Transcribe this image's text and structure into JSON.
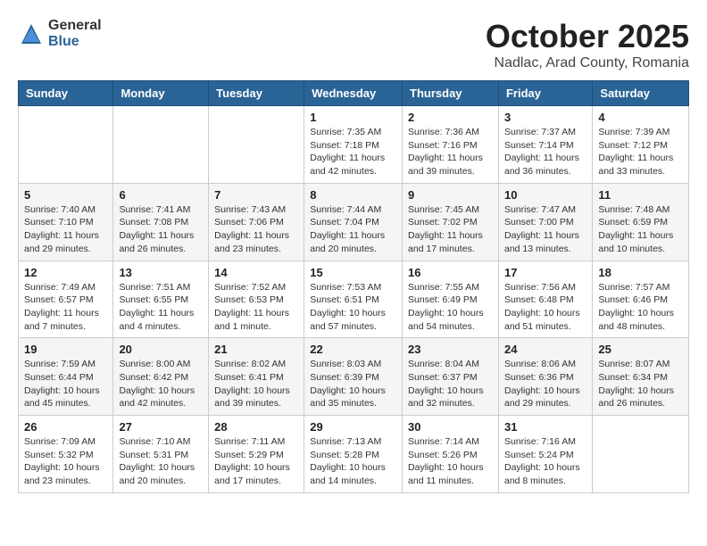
{
  "logo": {
    "general": "General",
    "blue": "Blue"
  },
  "header": {
    "month": "October 2025",
    "location": "Nadlac, Arad County, Romania"
  },
  "weekdays": [
    "Sunday",
    "Monday",
    "Tuesday",
    "Wednesday",
    "Thursday",
    "Friday",
    "Saturday"
  ],
  "weeks": [
    [
      {
        "day": "",
        "info": ""
      },
      {
        "day": "",
        "info": ""
      },
      {
        "day": "",
        "info": ""
      },
      {
        "day": "1",
        "info": "Sunrise: 7:35 AM\nSunset: 7:18 PM\nDaylight: 11 hours and 42 minutes."
      },
      {
        "day": "2",
        "info": "Sunrise: 7:36 AM\nSunset: 7:16 PM\nDaylight: 11 hours and 39 minutes."
      },
      {
        "day": "3",
        "info": "Sunrise: 7:37 AM\nSunset: 7:14 PM\nDaylight: 11 hours and 36 minutes."
      },
      {
        "day": "4",
        "info": "Sunrise: 7:39 AM\nSunset: 7:12 PM\nDaylight: 11 hours and 33 minutes."
      }
    ],
    [
      {
        "day": "5",
        "info": "Sunrise: 7:40 AM\nSunset: 7:10 PM\nDaylight: 11 hours and 29 minutes."
      },
      {
        "day": "6",
        "info": "Sunrise: 7:41 AM\nSunset: 7:08 PM\nDaylight: 11 hours and 26 minutes."
      },
      {
        "day": "7",
        "info": "Sunrise: 7:43 AM\nSunset: 7:06 PM\nDaylight: 11 hours and 23 minutes."
      },
      {
        "day": "8",
        "info": "Sunrise: 7:44 AM\nSunset: 7:04 PM\nDaylight: 11 hours and 20 minutes."
      },
      {
        "day": "9",
        "info": "Sunrise: 7:45 AM\nSunset: 7:02 PM\nDaylight: 11 hours and 17 minutes."
      },
      {
        "day": "10",
        "info": "Sunrise: 7:47 AM\nSunset: 7:00 PM\nDaylight: 11 hours and 13 minutes."
      },
      {
        "day": "11",
        "info": "Sunrise: 7:48 AM\nSunset: 6:59 PM\nDaylight: 11 hours and 10 minutes."
      }
    ],
    [
      {
        "day": "12",
        "info": "Sunrise: 7:49 AM\nSunset: 6:57 PM\nDaylight: 11 hours and 7 minutes."
      },
      {
        "day": "13",
        "info": "Sunrise: 7:51 AM\nSunset: 6:55 PM\nDaylight: 11 hours and 4 minutes."
      },
      {
        "day": "14",
        "info": "Sunrise: 7:52 AM\nSunset: 6:53 PM\nDaylight: 11 hours and 1 minute."
      },
      {
        "day": "15",
        "info": "Sunrise: 7:53 AM\nSunset: 6:51 PM\nDaylight: 10 hours and 57 minutes."
      },
      {
        "day": "16",
        "info": "Sunrise: 7:55 AM\nSunset: 6:49 PM\nDaylight: 10 hours and 54 minutes."
      },
      {
        "day": "17",
        "info": "Sunrise: 7:56 AM\nSunset: 6:48 PM\nDaylight: 10 hours and 51 minutes."
      },
      {
        "day": "18",
        "info": "Sunrise: 7:57 AM\nSunset: 6:46 PM\nDaylight: 10 hours and 48 minutes."
      }
    ],
    [
      {
        "day": "19",
        "info": "Sunrise: 7:59 AM\nSunset: 6:44 PM\nDaylight: 10 hours and 45 minutes."
      },
      {
        "day": "20",
        "info": "Sunrise: 8:00 AM\nSunset: 6:42 PM\nDaylight: 10 hours and 42 minutes."
      },
      {
        "day": "21",
        "info": "Sunrise: 8:02 AM\nSunset: 6:41 PM\nDaylight: 10 hours and 39 minutes."
      },
      {
        "day": "22",
        "info": "Sunrise: 8:03 AM\nSunset: 6:39 PM\nDaylight: 10 hours and 35 minutes."
      },
      {
        "day": "23",
        "info": "Sunrise: 8:04 AM\nSunset: 6:37 PM\nDaylight: 10 hours and 32 minutes."
      },
      {
        "day": "24",
        "info": "Sunrise: 8:06 AM\nSunset: 6:36 PM\nDaylight: 10 hours and 29 minutes."
      },
      {
        "day": "25",
        "info": "Sunrise: 8:07 AM\nSunset: 6:34 PM\nDaylight: 10 hours and 26 minutes."
      }
    ],
    [
      {
        "day": "26",
        "info": "Sunrise: 7:09 AM\nSunset: 5:32 PM\nDaylight: 10 hours and 23 minutes."
      },
      {
        "day": "27",
        "info": "Sunrise: 7:10 AM\nSunset: 5:31 PM\nDaylight: 10 hours and 20 minutes."
      },
      {
        "day": "28",
        "info": "Sunrise: 7:11 AM\nSunset: 5:29 PM\nDaylight: 10 hours and 17 minutes."
      },
      {
        "day": "29",
        "info": "Sunrise: 7:13 AM\nSunset: 5:28 PM\nDaylight: 10 hours and 14 minutes."
      },
      {
        "day": "30",
        "info": "Sunrise: 7:14 AM\nSunset: 5:26 PM\nDaylight: 10 hours and 11 minutes."
      },
      {
        "day": "31",
        "info": "Sunrise: 7:16 AM\nSunset: 5:24 PM\nDaylight: 10 hours and 8 minutes."
      },
      {
        "day": "",
        "info": ""
      }
    ]
  ]
}
